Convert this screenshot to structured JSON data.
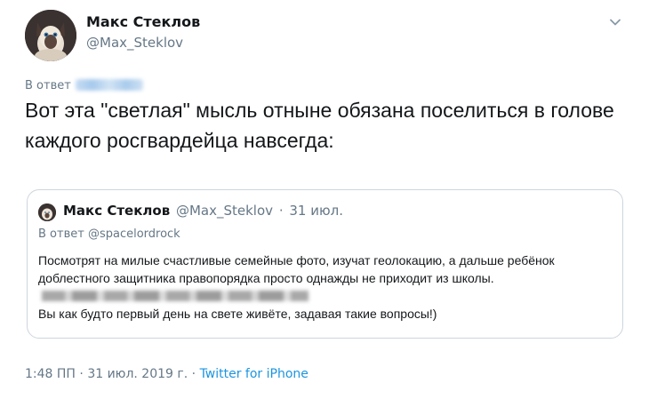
{
  "author": {
    "name": "Макс Стеклов",
    "handle": "@Max_Steklov"
  },
  "reply_prefix": "В ответ",
  "tweet_text": "Вот эта \"светлая\" мысль отныне обязана поселиться в голове каждого росгвардейца навсегда:",
  "quoted_tweet": {
    "name": "Макс Стеклов",
    "handle": "@Max_Steklov",
    "separator": "·",
    "date": "31 июл.",
    "reply_prefix": "В ответ",
    "reply_handle": "@spacelordrock",
    "text_part1": "Посмотрят на милые счастливые семейные фото, изучат геолокацию, а дальше ребёнок доблестного защитника правопорядка просто однажды не приходит из школы.",
    "text_part2": "Вы как будто первый день на свете живёте, задавая такие вопросы!)"
  },
  "footer": {
    "time": "1:48 ПП",
    "separator": "·",
    "date": "31 июл. 2019 г.",
    "separator2": "·",
    "source": "Twitter for iPhone"
  },
  "colors": {
    "text": "#14171a",
    "secondary": "#657786",
    "link": "#1b95e0",
    "border": "#ccd6dd"
  },
  "icons": {
    "menu": "chevron-down-icon"
  }
}
